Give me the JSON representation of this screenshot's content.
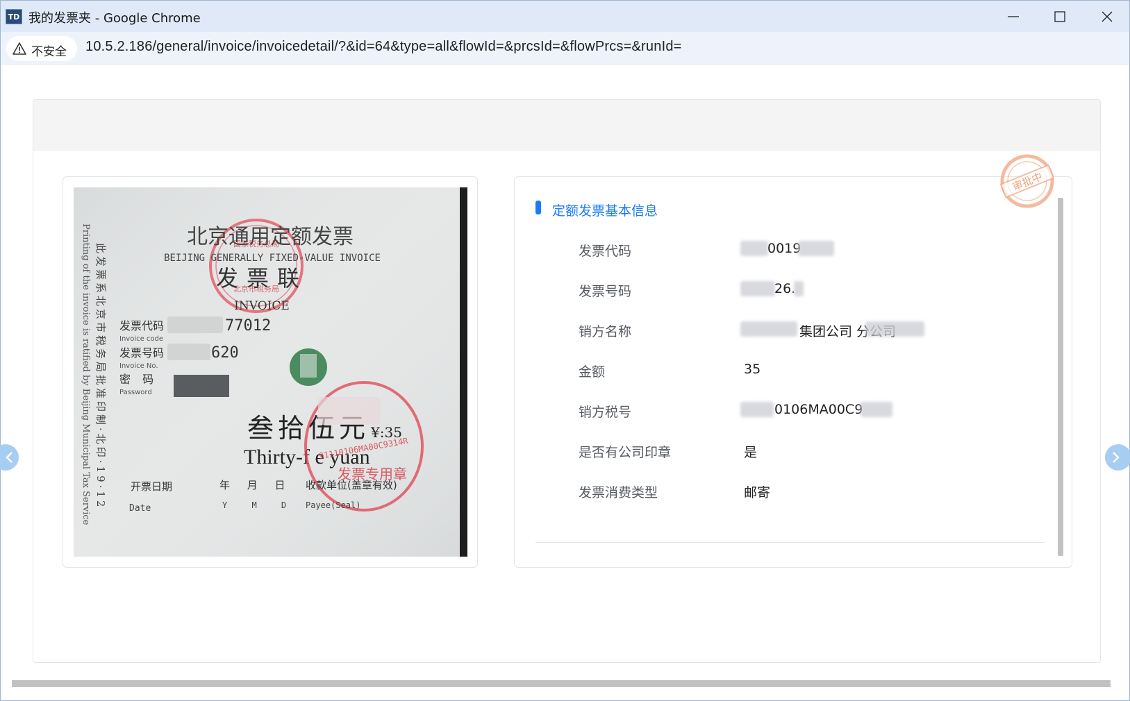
{
  "window": {
    "app_icon": "TD",
    "title": "我的发票夹 - Google Chrome"
  },
  "address_bar": {
    "security_label": "不安全",
    "url": "10.5.2.186/general/invoice/invoicedetail/?&id=64&type=all&flowId=&prcsId=&flowPrcs=&runId="
  },
  "invoice_image": {
    "title_cn": "北京通用定额发票",
    "title_en": "BEIJING GENERALLY FIXED-VALUE INVOICE",
    "copy_cn": "发票联",
    "copy_en": "INVOICE",
    "side_text_cn": "此发票系北京市税务局批准印制·北印·19·12",
    "side_text_en": "Printing of the invoice is ratified by Beijing Municipal Tax Service",
    "code_label": "发票代码",
    "code_label_en": "Invoice code",
    "code_value": "77012",
    "number_label": "发票号码",
    "number_label_en": "Invoice No.",
    "number_value": "620",
    "password_label": "密 码",
    "password_label_en": "Password",
    "amount_cn": "叁拾伍元",
    "amount_symbol": "¥:35",
    "amount_en": "Thirty-f  e yuan",
    "date_label": "开票日期",
    "date_label_en": "Date",
    "date_units": "年 月 日",
    "date_units_en": "Y M D",
    "payee_label": "收款单位(盖章有效)",
    "payee_label_en": "Payee(Seal)",
    "stamp_top_text": "北京市税务局",
    "stamp_top_text2": "国家税务总局",
    "stamp_bottom_text": "发票专用章",
    "stamp_bottom_code": "91110106MA00C9314R"
  },
  "info": {
    "section_title": "定额发票基本信息",
    "rows": [
      {
        "label": "发票代码",
        "value": "0019"
      },
      {
        "label": "发票号码",
        "value": "26."
      },
      {
        "label": "销方名称",
        "value": "集团公司       分公司"
      },
      {
        "label": "金额",
        "value": "35"
      },
      {
        "label": "销方税号",
        "value": "0106MA00C9"
      },
      {
        "label": "是否有公司印章",
        "value": "是"
      },
      {
        "label": "发票消费类型",
        "value": "邮寄"
      }
    ]
  },
  "status_stamp": {
    "text": "审批中",
    "color": "#f0a37e"
  },
  "colors": {
    "accent": "#1a7cf5",
    "nav_arrow": "#a8cdf3"
  }
}
